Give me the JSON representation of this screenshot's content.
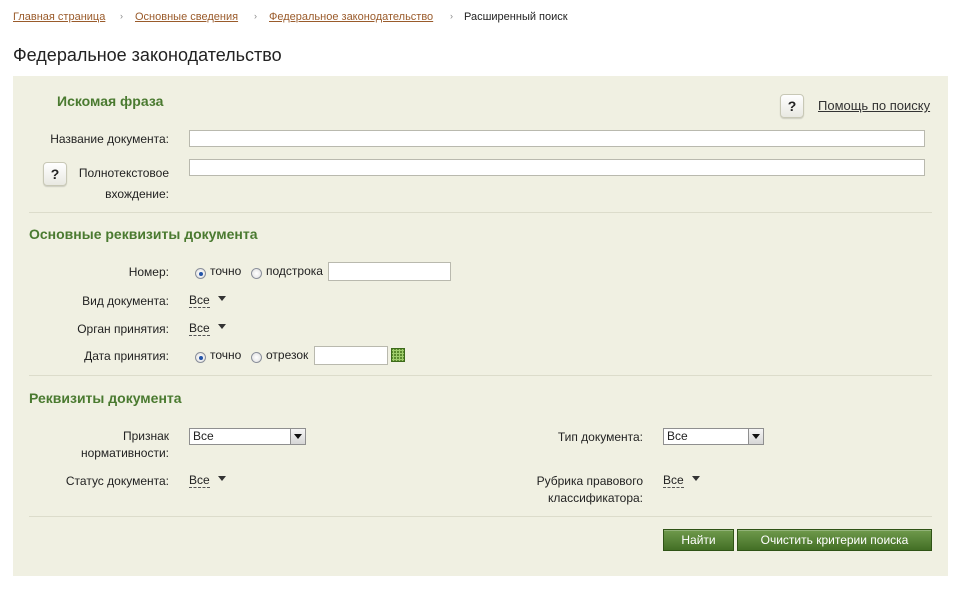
{
  "breadcrumb": {
    "items": [
      "Главная страница",
      "Основные сведения",
      "Федеральное законодательство"
    ],
    "current": "Расширенный поиск",
    "separator": "›"
  },
  "page": {
    "title": "Федеральное законодательство"
  },
  "search_phrase": {
    "title": "Искомая фраза",
    "help_label": "?",
    "help_link": "Помощь по поиску",
    "doc_name_label": "Название документа:",
    "doc_name_value": "",
    "fulltext_label_1": "Полнотекстовое",
    "fulltext_label_2": "вхождение:",
    "fulltext_value": ""
  },
  "main_requisites": {
    "title": "Основные реквизиты документа",
    "number_label": "Номер:",
    "number_opt_exact": "точно",
    "number_opt_substring": "подстрока",
    "number_value": "",
    "doc_type_label": "Вид документа:",
    "doc_type_value": "Все",
    "organ_label": "Орган принятия:",
    "organ_value": "Все",
    "date_label": "Дата принятия:",
    "date_opt_exact": "точно",
    "date_opt_range": "отрезок",
    "date_value": ""
  },
  "requisites": {
    "title": "Реквизиты документа",
    "normative_label_1": "Признак",
    "normative_label_2": "нормативности:",
    "normative_value": "Все",
    "doc_kind_label": "Тип документа:",
    "doc_kind_value": "Все",
    "status_label": "Статус документа:",
    "status_value": "Все",
    "rubric_label_1": "Рубрика правового",
    "rubric_label_2": "классификатора:",
    "rubric_value": "Все"
  },
  "actions": {
    "find": "Найти",
    "clear": "Очистить критерии поиска"
  },
  "colors": {
    "panel_bg": "#f0f0e2",
    "accent_green": "#4a7a30",
    "link_brown": "#9a5b2b",
    "button_green": "#436f25"
  },
  "icons": {
    "help": "question-mark-icon",
    "calendar": "calendar-icon",
    "dropdown": "triangle-down-icon"
  }
}
